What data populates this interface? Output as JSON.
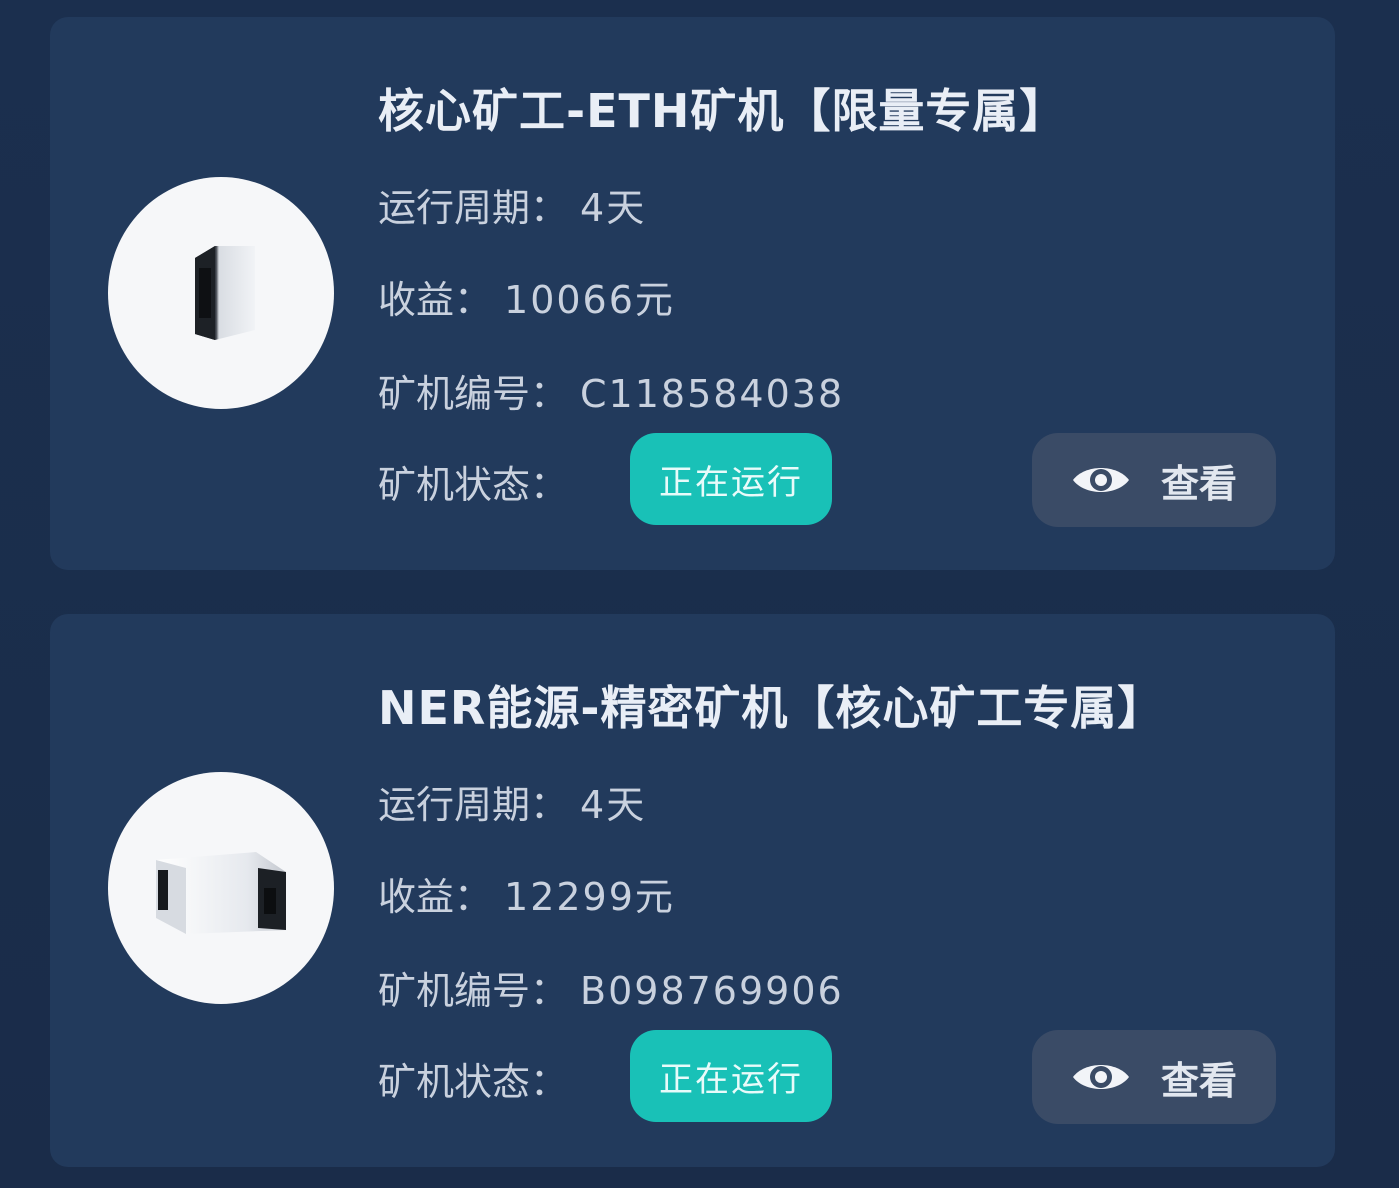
{
  "cards": [
    {
      "title": "核心矿工-ETH矿机【限量专属】",
      "period_label": "运行周期：",
      "period_value": "4天",
      "income_label": "收益：",
      "income_value": "10066元",
      "id_label": "矿机编号：",
      "id_value": "C118584038",
      "status_label": "矿机状态：",
      "status_value": "正在运行",
      "view_label": "查看",
      "image_icon": "mining-machine-icon"
    },
    {
      "title": "NER能源-精密矿机【核心矿工专属】",
      "period_label": "运行周期：",
      "period_value": "4天",
      "income_label": "收益：",
      "income_value": "12299元",
      "id_label": "矿机编号：",
      "id_value": "B098769906",
      "status_label": "矿机状态：",
      "status_value": "正在运行",
      "view_label": "查看",
      "image_icon": "mining-machine-icon"
    }
  ],
  "colors": {
    "background": "#1a2d4b",
    "card": "#223a5c",
    "status_pill": "#19c1b7",
    "view_button": "#3a4b66"
  }
}
